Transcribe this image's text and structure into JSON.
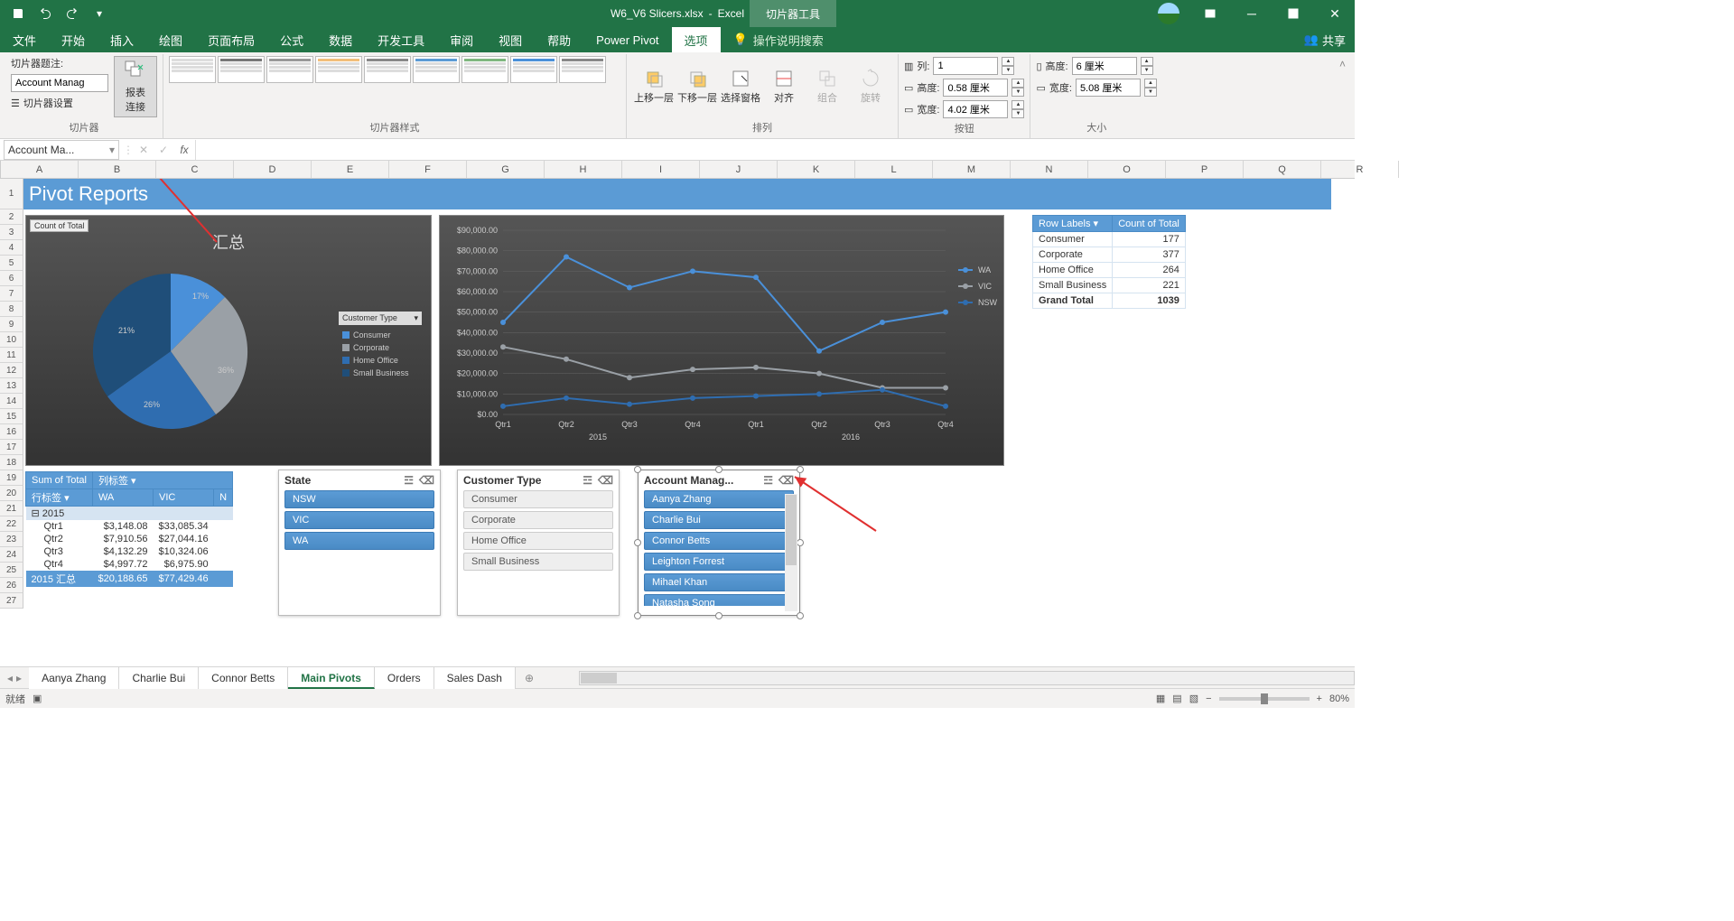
{
  "app": {
    "file": "W6_V6 Slicers.xlsx",
    "product": "Excel",
    "contextTool": "切片器工具",
    "share": "共享"
  },
  "tabs": [
    "文件",
    "开始",
    "插入",
    "绘图",
    "页面布局",
    "公式",
    "数据",
    "开发工具",
    "审阅",
    "视图",
    "帮助",
    "Power Pivot",
    "选项"
  ],
  "tellMe": "操作说明搜索",
  "ribbon": {
    "slicer": {
      "captionLabel": "切片器题注:",
      "captionValue": "Account Manag",
      "settings": "切片器设置",
      "connections": "报表\n连接",
      "groupLabel": "切片器"
    },
    "styles": {
      "groupLabel": "切片器样式"
    },
    "arrange": {
      "bringForward": "上移一层",
      "sendBackward": "下移一层",
      "selectionPane": "选择窗格",
      "align": "对齐",
      "group": "组合",
      "rotate": "旋转",
      "groupLabel": "排列"
    },
    "buttons": {
      "cols": "列:",
      "colsVal": "1",
      "height": "高度:",
      "heightVal": "0.58 厘米",
      "width": "宽度:",
      "widthVal": "4.02 厘米",
      "groupLabel": "按钮"
    },
    "size": {
      "height": "高度:",
      "heightVal": "6 厘米",
      "width": "宽度:",
      "widthVal": "5.08 厘米",
      "groupLabel": "大小"
    }
  },
  "nameBox": "Account Ma...",
  "columns": [
    "A",
    "B",
    "C",
    "D",
    "E",
    "F",
    "G",
    "H",
    "I",
    "J",
    "K",
    "L",
    "M",
    "N",
    "O",
    "P",
    "Q",
    "R"
  ],
  "rows": [
    1,
    2,
    3,
    4,
    5,
    6,
    7,
    8,
    9,
    10,
    11,
    12,
    13,
    14,
    15,
    16,
    17,
    18,
    19,
    20,
    21,
    22,
    23,
    24,
    25,
    26,
    27
  ],
  "titleRow": "Pivot Reports",
  "pivCount": {
    "headers": [
      "Row Labels",
      "Count of Total"
    ],
    "rows": [
      [
        "Consumer",
        "177"
      ],
      [
        "Corporate",
        "377"
      ],
      [
        "Home Office",
        "264"
      ],
      [
        "Small Business",
        "221"
      ]
    ],
    "grand": [
      "Grand Total",
      "1039"
    ]
  },
  "pie": {
    "badge": "Count of Total",
    "title": "汇总",
    "legendHeader": "Customer Type",
    "legend": [
      {
        "name": "Consumer",
        "color": "#4a90d9"
      },
      {
        "name": "Corporate",
        "color": "#9aa0a6"
      },
      {
        "name": "Home Office",
        "color": "#2f6db0"
      },
      {
        "name": "Small Business",
        "color": "#1f4e79"
      }
    ],
    "labels": [
      "17%",
      "21%",
      "26%",
      "36%"
    ]
  },
  "lineLegend": [
    {
      "name": "WA",
      "color": "#4a90d9"
    },
    {
      "name": "VIC",
      "color": "#9aa0a6"
    },
    {
      "name": "NSW",
      "color": "#2f6db0"
    }
  ],
  "chart_data": {
    "type": "line",
    "x": [
      "Qtr1",
      "Qtr2",
      "Qtr3",
      "Qtr4",
      "Qtr1",
      "Qtr2",
      "Qtr3",
      "Qtr4"
    ],
    "xGroups": [
      {
        "label": "2015",
        "span": [
          0,
          3
        ]
      },
      {
        "label": "2016",
        "span": [
          4,
          7
        ]
      }
    ],
    "series": [
      {
        "name": "WA",
        "values": [
          45000,
          77000,
          62000,
          70000,
          67000,
          31000,
          45000,
          50000
        ]
      },
      {
        "name": "VIC",
        "values": [
          33000,
          27000,
          18000,
          22000,
          23000,
          20000,
          13000,
          13000
        ]
      },
      {
        "name": "NSW",
        "values": [
          4000,
          8000,
          5000,
          8000,
          9000,
          10000,
          12000,
          4000
        ]
      }
    ],
    "ylabelTicks": [
      "$0.00",
      "$10,000.00",
      "$20,000.00",
      "$30,000.00",
      "$40,000.00",
      "$50,000.00",
      "$60,000.00",
      "$70,000.00",
      "$80,000.00",
      "$90,000.00"
    ],
    "ylim": [
      0,
      90000
    ]
  },
  "lowGrid": {
    "h": [
      "Sum of Total",
      "列标签"
    ],
    "cols": [
      "行标签",
      "WA",
      "VIC",
      "N"
    ],
    "yr": "2015",
    "rows": [
      [
        "Qtr1",
        "$3,148.08",
        "$33,085.34"
      ],
      [
        "Qtr2",
        "$7,910.56",
        "$27,044.16"
      ],
      [
        "Qtr3",
        "$4,132.29",
        "$10,324.06"
      ],
      [
        "Qtr4",
        "$4,997.72",
        "$6,975.90"
      ]
    ],
    "tot": [
      "2015 汇总",
      "$20,188.65",
      "$77,429.46"
    ]
  },
  "slicers": {
    "state": {
      "title": "State",
      "items": [
        "NSW",
        "VIC",
        "WA"
      ],
      "selected": [
        0,
        1,
        2
      ]
    },
    "ctype": {
      "title": "Customer Type",
      "items": [
        "Consumer",
        "Corporate",
        "Home Office",
        "Small Business"
      ],
      "selected": []
    },
    "mgr": {
      "title": "Account Manag...",
      "items": [
        "Aanya Zhang",
        "Charlie Bui",
        "Connor Betts",
        "Leighton Forrest",
        "Mihael Khan",
        "Natasha Song"
      ],
      "selected": [
        0,
        1,
        2,
        3,
        4,
        5
      ]
    }
  },
  "sheetTabs": [
    "Aanya Zhang",
    "Charlie Bui",
    "Connor Betts",
    "Main Pivots",
    "Orders",
    "Sales Dash"
  ],
  "activeSheet": 3,
  "status": {
    "ready": "就绪",
    "zoom": "80%"
  }
}
